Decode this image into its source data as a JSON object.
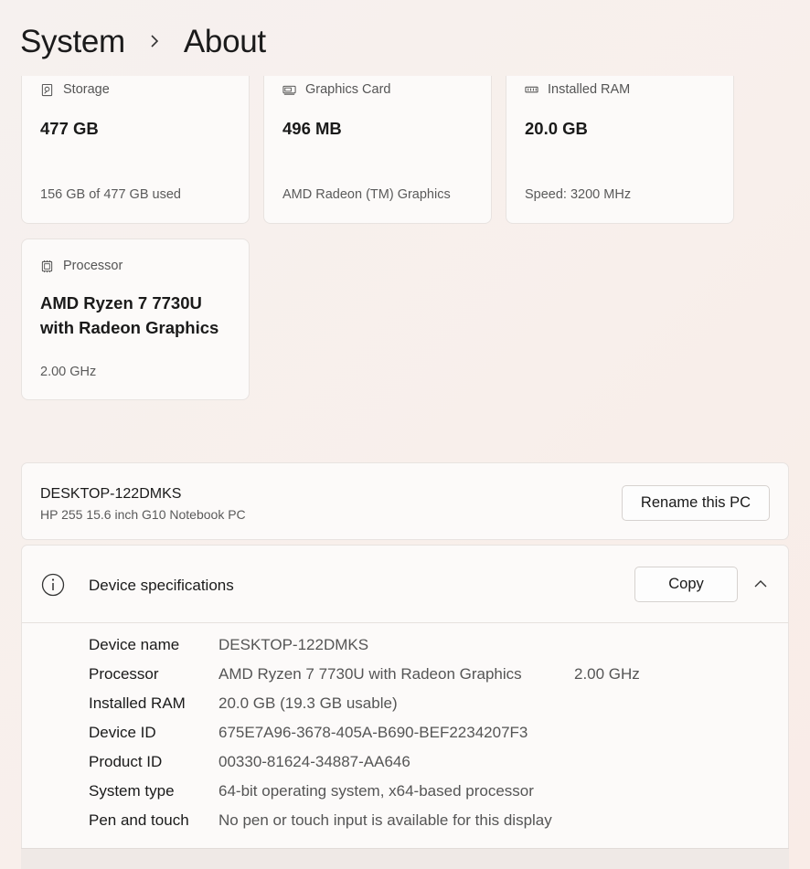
{
  "breadcrumb": {
    "parent": "System",
    "current": "About"
  },
  "cards": [
    {
      "label": "Storage",
      "value": "477 GB",
      "sub": "156 GB of 477 GB used",
      "icon": "storage-icon"
    },
    {
      "label": "Graphics Card",
      "value": "496 MB",
      "sub": "AMD Radeon (TM) Graphics",
      "icon": "graphics-card-icon"
    },
    {
      "label": "Installed RAM",
      "value": "20.0 GB",
      "sub": "Speed: 3200 MHz",
      "icon": "ram-icon"
    },
    {
      "label": "Processor",
      "value_line1": "AMD Ryzen 7 7730U",
      "value_line2": "with Radeon Graphics",
      "sub": "2.00 GHz",
      "icon": "processor-icon"
    }
  ],
  "pc": {
    "name": "DESKTOP-122DMKS",
    "model": "HP 255 15.6 inch G10 Notebook PC",
    "rename_label": "Rename this PC"
  },
  "specs": {
    "title": "Device specifications",
    "copy_label": "Copy",
    "rows": [
      {
        "key": "Device name",
        "value": "DESKTOP-122DMKS",
        "extra": ""
      },
      {
        "key": "Processor",
        "value": "AMD Ryzen 7 7730U with Radeon Graphics",
        "extra": "2.00 GHz"
      },
      {
        "key": "Installed RAM",
        "value": "20.0 GB (19.3 GB usable)",
        "extra": ""
      },
      {
        "key": "Device ID",
        "value": "675E7A96-3678-405A-B690-BEF2234207F3",
        "extra": ""
      },
      {
        "key": "Product ID",
        "value": "00330-81624-34887-AA646",
        "extra": ""
      },
      {
        "key": "System type",
        "value": "64-bit operating system, x64-based processor",
        "extra": ""
      },
      {
        "key": "Pen and touch",
        "value": "No pen or touch input is available for this display",
        "extra": ""
      }
    ]
  }
}
